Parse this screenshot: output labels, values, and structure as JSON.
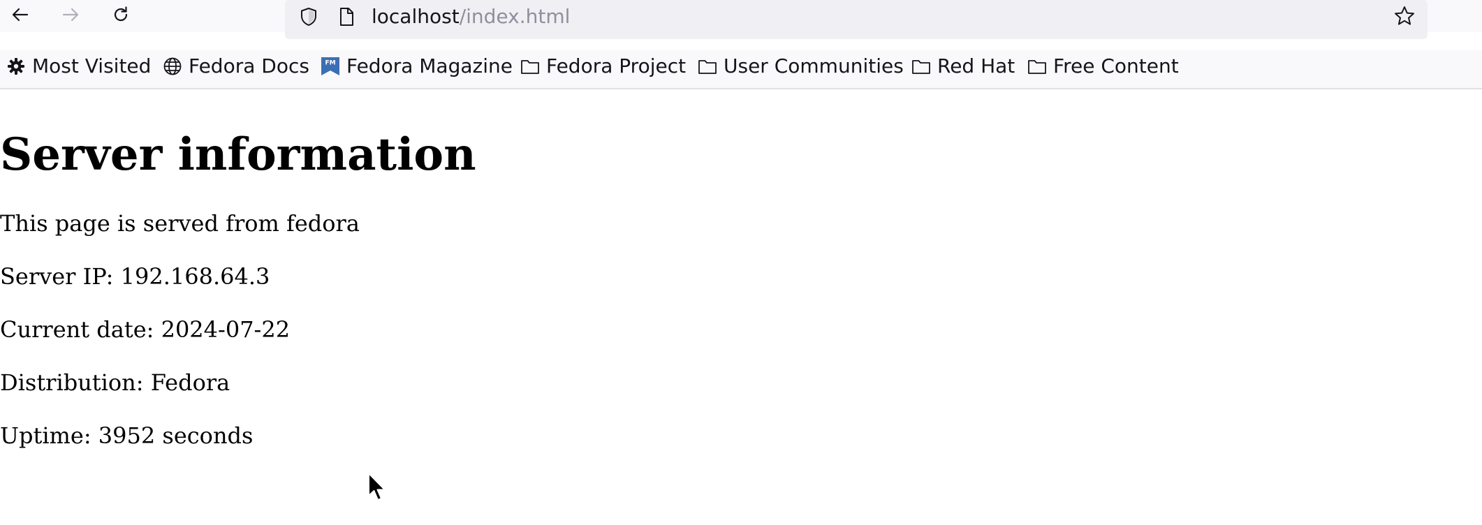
{
  "window": {
    "url_host": "localhost",
    "url_path": "/index.html"
  },
  "toolbar": {
    "back_icon": "arrow-left-icon",
    "forward_icon": "arrow-right-icon",
    "reload_icon": "reload-icon",
    "shield_icon": "shield-icon",
    "page_icon": "page-icon",
    "star_icon": "star-icon"
  },
  "bookmarks": {
    "items": [
      {
        "label": "Most Visited",
        "icon": "gear-icon"
      },
      {
        "label": "Fedora Docs",
        "icon": "globe-icon"
      },
      {
        "label": "Fedora Magazine",
        "icon": "fedora-magazine-icon"
      },
      {
        "label": "Fedora Project",
        "icon": "folder-icon"
      },
      {
        "label": "User Communities",
        "icon": "folder-icon"
      },
      {
        "label": "Red Hat",
        "icon": "folder-icon"
      },
      {
        "label": "Free Content",
        "icon": "folder-icon"
      }
    ]
  },
  "page": {
    "title": "Server information",
    "served_from": "This page is served from fedora",
    "server_ip": "Server IP: 192.168.64.3",
    "current_date": "Current date: 2024-07-22",
    "distribution": "Distribution: Fedora",
    "uptime": "Uptime: 3952 seconds"
  },
  "colors": {
    "toolbar_bg": "#f9f9fb",
    "urlbar_bg": "#f0f0f4",
    "url_path": "#8f8f9d",
    "magazine_brand": "#3c6eb4"
  }
}
